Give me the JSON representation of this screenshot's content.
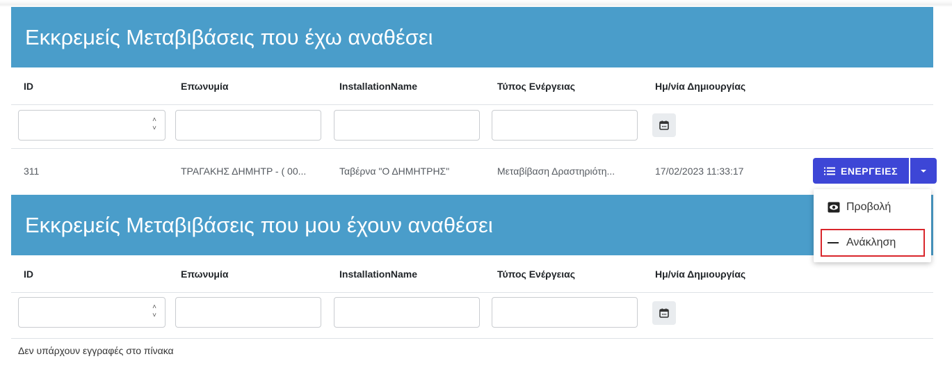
{
  "panel1": {
    "title": "Εκκρεμείς Μεταβιβάσεις που έχω αναθέσει",
    "columns": [
      "ID",
      "Επωνυμία",
      "InstallationName",
      "Τύπος Ενέργειας",
      "Ημ/νία Δημιουργίας"
    ],
    "row": {
      "id": "311",
      "name": "ΤΡΑΓΑΚΗΣ ΔΗΜΗΤΡ - ( 00...",
      "installation": "Ταβέρνα \"Ο ΔΗΜΗΤΡΗΣ\"",
      "type": "Μεταβίβαση Δραστηριότη...",
      "created": "17/02/2023 11:33:17"
    },
    "actions_label": "ΕΝΕΡΓΕΙΕΣ"
  },
  "panel2": {
    "title": "Εκκρεμείς Μεταβιβάσεις που μου έχουν αναθέσει",
    "columns": [
      "ID",
      "Επωνυμία",
      "InstallationName",
      "Τύπος Ενέργειας",
      "Ημ/νία Δημιουργίας"
    ],
    "empty_text": "Δεν υπάρχουν εγγραφές στο πίνακα"
  },
  "dropdown": {
    "items": [
      {
        "label": "Προβολή",
        "icon": "eye-icon"
      },
      {
        "label": "Ανάκληση",
        "icon": "minus-icon"
      }
    ]
  },
  "colors": {
    "header_bg": "#4a9dca",
    "button_bg": "#3d46d6",
    "highlight_border": "#d9262b"
  }
}
